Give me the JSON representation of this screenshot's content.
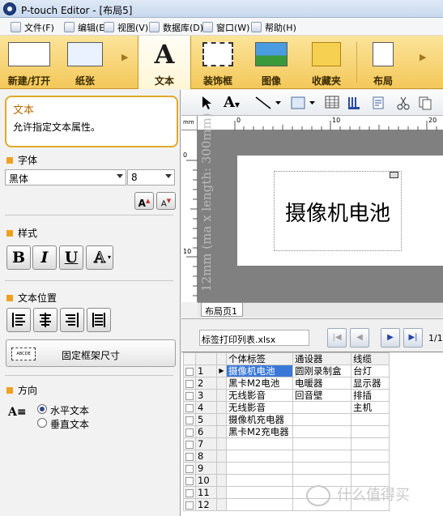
{
  "window": {
    "title": "P-touch Editor - [布局5]"
  },
  "menu": [
    "文件(F)",
    "编辑(E)",
    "视图(V)",
    "数据库(D)",
    "窗口(W)",
    "帮助(H)"
  ],
  "ribbon": {
    "tabs": [
      "新建/打开",
      "纸张",
      "文本",
      "装饰框",
      "图像",
      "收藏夹",
      "布局"
    ],
    "active": "文本"
  },
  "help": {
    "title": "文本",
    "text": "允许指定文本属性。"
  },
  "font_section": {
    "title": "字体",
    "font": "黑体",
    "size": "8",
    "grow": "A",
    "shrink": "A"
  },
  "style_section": {
    "title": "样式",
    "bold": "B",
    "italic": "I",
    "underline": "U",
    "outline": "A"
  },
  "position_section": {
    "title": "文本位置",
    "fixed_frame": "固定框架尺寸",
    "fixed_icon": "ABCDE"
  },
  "direction_section": {
    "title": "方向",
    "horizontal": "水平文本",
    "vertical": "垂直文本",
    "selected": "horizontal"
  },
  "toolbar": {
    "text_tool": "A"
  },
  "ruler": {
    "unit": "mm",
    "h_ticks": [
      "0",
      "10",
      "20"
    ],
    "v_ticks": [
      "0",
      "10"
    ]
  },
  "canvas": {
    "label_text": "摄像机电池",
    "side_text": "12mm (ma x length: 300mm)",
    "layout_tab": "布局页1"
  },
  "database": {
    "file": "标签打印列表.xlsx",
    "page": "1/12",
    "columns": [
      "个体标签",
      "通设器",
      "线缆"
    ],
    "rows": [
      [
        "1",
        "摄像机电池",
        "圆刚录制盒",
        "台灯"
      ],
      [
        "2",
        "黑卡M2电池",
        "电暖器",
        "显示器"
      ],
      [
        "3",
        "无线影音",
        "回音壁",
        "排插"
      ],
      [
        "4",
        "无线影音",
        "",
        "主机"
      ],
      [
        "5",
        "摄像机充电器",
        "",
        ""
      ],
      [
        "6",
        "黑卡M2充电器",
        "",
        ""
      ],
      [
        "7",
        "",
        "",
        ""
      ],
      [
        "8",
        "",
        "",
        ""
      ],
      [
        "9",
        "",
        "",
        ""
      ],
      [
        "10",
        "",
        "",
        ""
      ],
      [
        "11",
        "",
        "",
        ""
      ],
      [
        "12",
        "",
        "",
        ""
      ]
    ]
  },
  "watermark": "什么值得买"
}
